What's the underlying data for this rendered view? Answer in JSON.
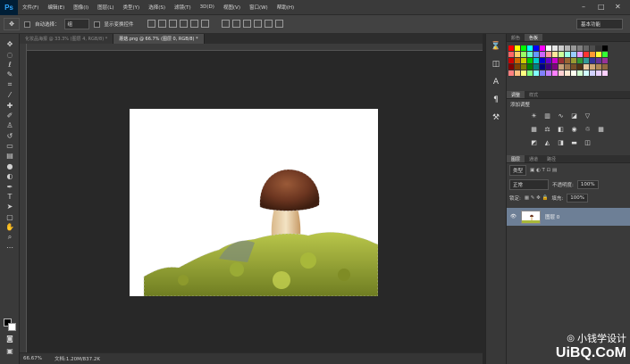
{
  "app": {
    "logo": "Ps"
  },
  "menubar": {
    "items": [
      "文件(F)",
      "编辑(E)",
      "图像(I)",
      "图层(L)",
      "类型(Y)",
      "选择(S)",
      "滤镜(T)",
      "3D(D)",
      "视图(V)",
      "窗口(W)",
      "帮助(H)"
    ],
    "minimize": "–",
    "maximize": "□",
    "close": "✕"
  },
  "optionsbar": {
    "auto_select_label": "自动选择：",
    "auto_select_value": "组",
    "transform_label": "显示变换控件",
    "workspace": "基本功能"
  },
  "tabs": [
    {
      "label": "化妆品海报 @ 33.3% (图层 4, RGB/8) *",
      "active": false
    },
    {
      "label": "蘑菇.png @ 66.7% (图层 0, RGB/8) *",
      "active": true
    }
  ],
  "status": {
    "zoom": "66.67%",
    "doc": "文档:1.20M/837.2K"
  },
  "panels": {
    "color_tabs": [
      "颜色",
      "色板"
    ],
    "adjust_tabs": [
      "调整",
      "样式"
    ],
    "adjust_title": "添加调整",
    "layer_tabs": [
      "图层",
      "通道",
      "路径"
    ],
    "kind_label": "类型",
    "blend_mode": "正常",
    "opacity_label": "不透明度:",
    "opacity_value": "100%",
    "lock_label": "锁定:",
    "fill_label": "填充:",
    "fill_value": "100%",
    "layer_name": "图层 0"
  },
  "watermark": {
    "top": "小钱学设计",
    "bottom": "UiBQ.CoM"
  },
  "swatch_colors": [
    "#ff0000",
    "#ffff00",
    "#00ff00",
    "#00ffff",
    "#0000ff",
    "#ff00ff",
    "#ffffff",
    "#e6e6e6",
    "#cccccc",
    "#b3b3b3",
    "#999999",
    "#808080",
    "#666666",
    "#4d4d4d",
    "#333333",
    "#000000",
    "#ff6666",
    "#ffcc66",
    "#99ff66",
    "#66ffcc",
    "#6699ff",
    "#cc66ff",
    "#ff9999",
    "#ffe699",
    "#ccff99",
    "#99ffe6",
    "#99ccff",
    "#e699ff",
    "#ff3333",
    "#ff9933",
    "#ffff33",
    "#33ff33",
    "#cc0000",
    "#cc6600",
    "#cccc00",
    "#00cc00",
    "#00cccc",
    "#0000cc",
    "#6600cc",
    "#cc00cc",
    "#993333",
    "#996633",
    "#999933",
    "#339933",
    "#339999",
    "#333399",
    "#663399",
    "#993399",
    "#800000",
    "#804000",
    "#808000",
    "#008000",
    "#008080",
    "#000080",
    "#400080",
    "#800080",
    "#c8a078",
    "#a07850",
    "#785028",
    "#503214",
    "#e8c8a0",
    "#d0a878",
    "#b08858",
    "#906840",
    "#ff8080",
    "#ffc080",
    "#ffff80",
    "#80ff80",
    "#80ffff",
    "#8080ff",
    "#c080ff",
    "#ff80ff",
    "#ffd0d0",
    "#ffe8d0",
    "#fffff0",
    "#d0ffd0",
    "#d0ffff",
    "#d0d0ff",
    "#e8d0ff",
    "#ffd0ff"
  ]
}
